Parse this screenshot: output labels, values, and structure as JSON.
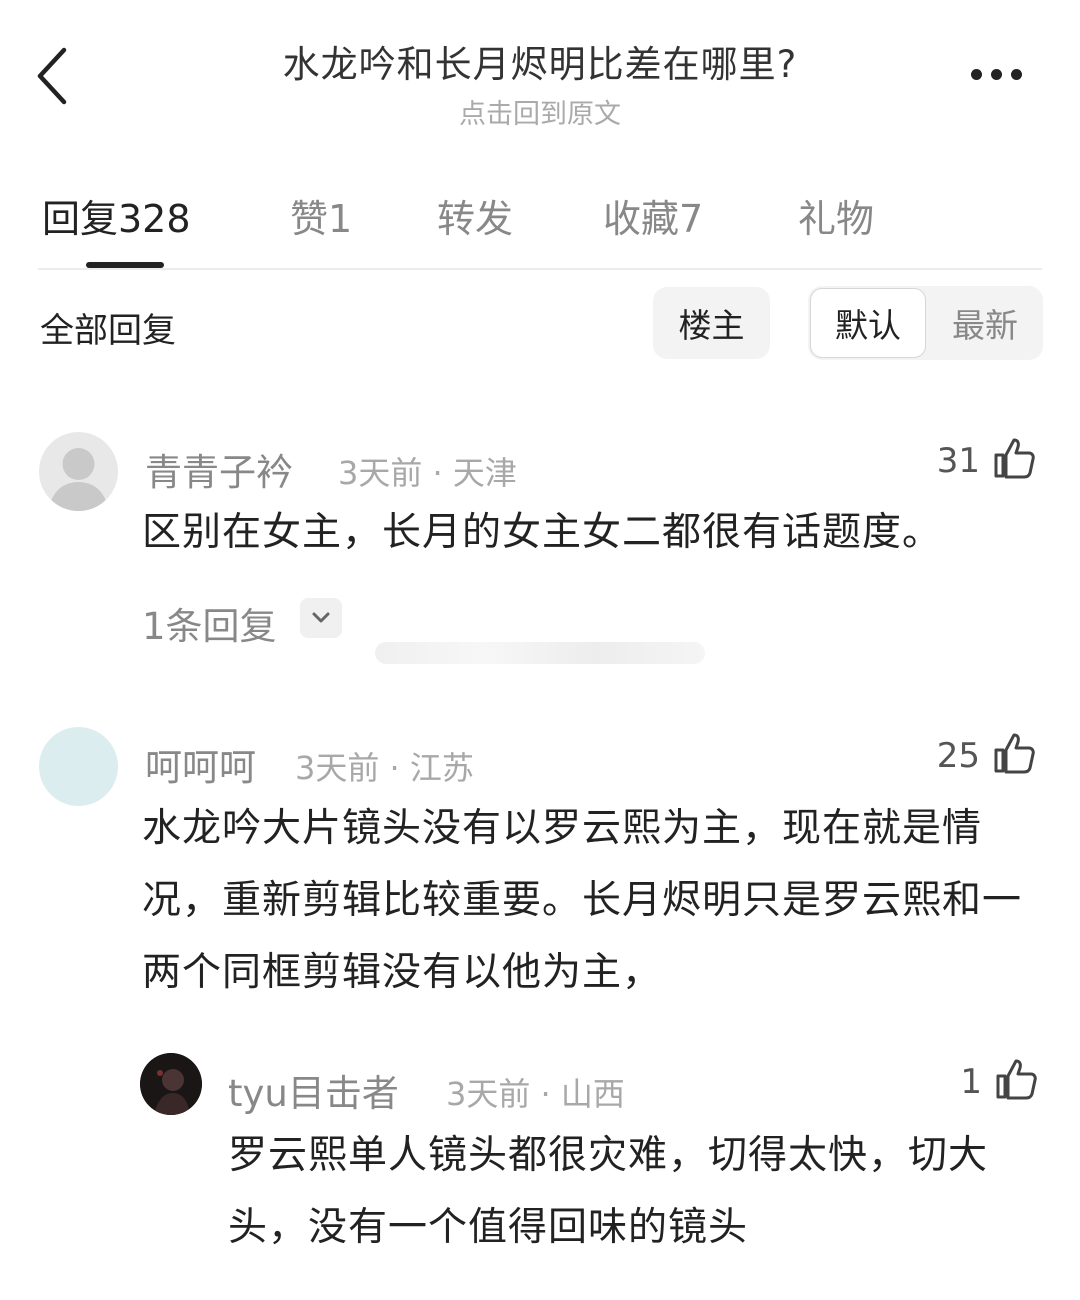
{
  "header": {
    "title": "水龙吟和长月烬明比差在哪里?",
    "subtitle": "点击回到原文"
  },
  "tabs": [
    {
      "label": "回复328",
      "active": true
    },
    {
      "label": "赞1",
      "active": false
    },
    {
      "label": "转发",
      "active": false
    },
    {
      "label": "收藏7",
      "active": false
    },
    {
      "label": "礼物",
      "active": false
    }
  ],
  "filter": {
    "all_label": "全部回复",
    "op_label": "楼主",
    "sort_options": [
      {
        "label": "默认",
        "selected": true
      },
      {
        "label": "最新",
        "selected": false
      }
    ]
  },
  "comments": [
    {
      "username": "青青子衿",
      "time": "3天前",
      "location": "天津",
      "likes": "31",
      "text": "区别在女主，长月的女主女二都很有话题度。",
      "replies_label": "1条回复"
    },
    {
      "username": "呵呵呵",
      "time": "3天前",
      "location": "江苏",
      "likes": "25",
      "text": "水龙吟大片镜头没有以罗云熙为主，现在就是情况，重新剪辑比较重要。长月烬明只是罗云熙和一两个同框剪辑没有以他为主，",
      "reply": {
        "username": "tyu目击者",
        "time": "3天前",
        "location": "山西",
        "likes": "1",
        "text": "罗云熙单人镜头都很灾难，切得太快，切大头，没有一个值得回味的镜头"
      }
    }
  ],
  "icons": {
    "back": "chevron-left-icon",
    "more": "more-dots-icon",
    "like": "thumbs-up-icon",
    "expand": "chevron-down-icon"
  },
  "colors": {
    "text_primary": "#222222",
    "text_secondary": "#888888",
    "chip_bg": "#f3f3f3"
  }
}
